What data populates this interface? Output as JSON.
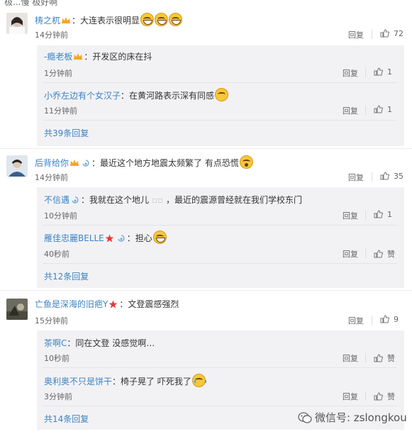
{
  "top_cut_text": "极...慢   极好啊",
  "comments": [
    {
      "user": "梼之杌",
      "text": "：大连表示很明显",
      "time": "14分钟前",
      "reply": "回复",
      "likes": "72",
      "sub_replies": [
        {
          "user": "-瘾老板",
          "text": "：开发区的床在抖",
          "time": "1分钟前",
          "reply": "回复",
          "likes": "1"
        },
        {
          "user": "小乔左边有个女汉子",
          "text": "：在黄河路表示深有同感",
          "time": "11分钟前",
          "reply": "回复",
          "likes": "1"
        }
      ],
      "more": "共39条回复"
    },
    {
      "user": "后背给你",
      "text": "：最近这个地方地震太频繁了 有点恐慌",
      "time": "14分钟前",
      "reply": "回复",
      "likes": "35",
      "sub_replies": [
        {
          "user": "不信遇",
          "text": "：我就在这个地儿",
          "text2": "，最近的震源曾经就在我们学校东门",
          "time": "10分钟前",
          "reply": "回复",
          "likes": "1"
        },
        {
          "user": "雁佳忠麗BELLE",
          "text": "：担心",
          "time": "40秒前",
          "reply": "回复",
          "likes": "赞"
        }
      ],
      "more": "共12条回复"
    },
    {
      "user": "亡鱼是深海的旧疤Y",
      "text": "：文登震感强烈",
      "time": "15分钟前",
      "reply": "回复",
      "likes": "9",
      "sub_replies": [
        {
          "user": "茶啊C",
          "text": "：同在文登 没感觉啊…",
          "time": "10秒前",
          "reply": "回复",
          "likes": "赞"
        },
        {
          "user": "奥利奥不只是饼干",
          "text": "：椅子晃了 吓死我了",
          "time": "3分钟前",
          "reply": "回复",
          "likes": "赞"
        }
      ],
      "more": "共14条回复"
    }
  ],
  "watermark": "微信号: zslongkou",
  "colors": {
    "link": "#3d83c1",
    "accent": "#eb7350",
    "sub_bg": "#f2f2f5"
  }
}
